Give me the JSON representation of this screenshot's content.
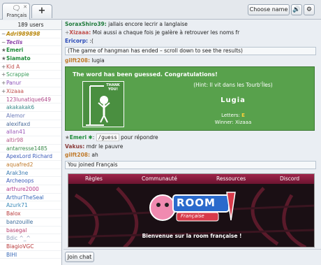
{
  "tabs": [
    {
      "label": "Français",
      "icon": "speech-bubble-icon"
    }
  ],
  "header": {
    "add_tab": "+",
    "choose_name": "Choose name",
    "sound_icon": "speaker-icon",
    "settings_icon": "gear-icon"
  },
  "userlist": {
    "count": "189 users",
    "users": [
      {
        "rank": "~",
        "name": "Adri989898",
        "color": "#b8860b",
        "italic": true,
        "bold": true
      },
      {
        "rank": "~",
        "name": "Teclis",
        "color": "#8a3fa8",
        "italic": true,
        "bold": true
      },
      {
        "rank": "★",
        "name": "Emeri",
        "color": "#1e8c3a",
        "italic": false,
        "bold": true
      },
      {
        "rank": "★",
        "name": "Siamato",
        "color": "#1e8c3a",
        "italic": false,
        "bold": true
      },
      {
        "rank": "+",
        "name": "Kid A",
        "color": "#c0504d",
        "italic": false,
        "bold": false
      },
      {
        "rank": "+",
        "name": "Scrappie",
        "color": "#3a9c5a",
        "italic": false,
        "bold": false
      },
      {
        "rank": "+",
        "name": "Panur",
        "color": "#8a4fb8",
        "italic": false,
        "bold": false
      },
      {
        "rank": "+",
        "name": "Xizaaa",
        "color": "#c0504d",
        "italic": false,
        "bold": false
      },
      {
        "rank": "",
        "name": "123lunatique649",
        "color": "#b04a8a",
        "italic": false,
        "bold": false
      },
      {
        "rank": "",
        "name": "akakakak6",
        "color": "#3a8a8a",
        "italic": false,
        "bold": false
      },
      {
        "rank": "",
        "name": "Alemor",
        "color": "#6a7ab8",
        "italic": false,
        "bold": false
      },
      {
        "rank": "",
        "name": "alexifaxd",
        "color": "#4a6a9a",
        "italic": false,
        "bold": false
      },
      {
        "rank": "",
        "name": "allan41",
        "color": "#9a5ab8",
        "italic": false,
        "bold": false
      },
      {
        "rank": "",
        "name": "altir98",
        "color": "#b85a8a",
        "italic": false,
        "bold": false
      },
      {
        "rank": "",
        "name": "antarresse1485",
        "color": "#3a8a4a",
        "italic": false,
        "bold": false
      },
      {
        "rank": "",
        "name": "ApexLord Richard",
        "color": "#3a5ab8",
        "italic": false,
        "bold": false
      },
      {
        "rank": "",
        "name": "aquafred2",
        "color": "#c07a2a",
        "italic": false,
        "bold": false
      },
      {
        "rank": "",
        "name": "Arak3ne",
        "color": "#3a7ab0",
        "italic": false,
        "bold": false
      },
      {
        "rank": "",
        "name": "Archeoops",
        "color": "#3a5ab8",
        "italic": false,
        "bold": false
      },
      {
        "rank": "",
        "name": "arthure2000",
        "color": "#b83a8a",
        "italic": false,
        "bold": false
      },
      {
        "rank": "",
        "name": "ArthurTheSeal",
        "color": "#3a6ab8",
        "italic": false,
        "bold": false
      },
      {
        "rank": "",
        "name": "Azurk71",
        "color": "#3a8ab8",
        "italic": false,
        "bold": false
      },
      {
        "rank": "",
        "name": "Balox",
        "color": "#b83a3a",
        "italic": false,
        "bold": false
      },
      {
        "rank": "",
        "name": "banzouille",
        "color": "#3a6a9a",
        "italic": false,
        "bold": false
      },
      {
        "rank": "",
        "name": "basegal",
        "color": "#b83a6a",
        "italic": false,
        "bold": false
      },
      {
        "rank": "",
        "name": "Bdic ^_^",
        "color": "#8a9ab8",
        "italic": false,
        "bold": false
      },
      {
        "rank": "",
        "name": "BiagioVGC",
        "color": "#b83a3a",
        "italic": false,
        "bold": false
      },
      {
        "rank": "",
        "name": "BIHI",
        "color": "#3a6ab8",
        "italic": false,
        "bold": false
      }
    ]
  },
  "chat": {
    "m1": {
      "user": "SoraxShiro39:",
      "user_color": "#1e7a3a",
      "text": "jallais encore lecrir a langlaise"
    },
    "m2": {
      "rank": "+",
      "user": "Xizaaa:",
      "user_color": "#c0504d",
      "text": "Moi aussi a chaque fois je galère à retrouver les noms fr"
    },
    "m3": {
      "user": "Ericorp:",
      "user_color": "#2a4ab8",
      "text": ":("
    },
    "notice1": "(The game of hangman has ended – scroll down to see the results)",
    "m4": {
      "user": "gilft208:",
      "user_color": "#c07a2a",
      "text": "lugia"
    },
    "hangman": {
      "title": "The word has been guessed. Congratulations!",
      "thanks": "THANK YOU!",
      "hint": "(Hint: Il vit dans les Tourb'Îles)",
      "word": "Lugia",
      "letters_label": "Letters: ",
      "letters_value": "E",
      "winner": "Winner: Xizaaa"
    },
    "m5": {
      "rank": "★",
      "user": "Emeri",
      "user_color": "#1e8c3a",
      "code": "/guess",
      "text": "pour répondre"
    },
    "m6": {
      "user": "Vakus:",
      "user_color": "#8a3a3a",
      "text": "mdr le pauvre"
    },
    "m7": {
      "user": "gilft208:",
      "user_color": "#c07a2a",
      "text": "ah"
    },
    "notice2": "You joined Français",
    "banner": {
      "nav": [
        "Règles",
        "Communauté",
        "Ressources",
        "Discord"
      ],
      "logo_text": "ROOM",
      "logo_sub": "Française",
      "caption": "Bienvenue sur la room française !"
    }
  },
  "footer": {
    "join_chat": "Join chat"
  }
}
